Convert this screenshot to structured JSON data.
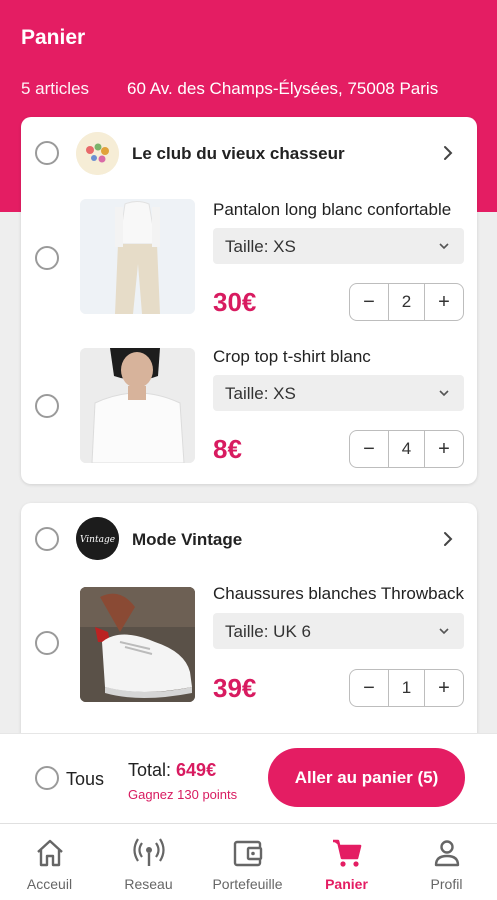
{
  "header": {
    "title": "Panier",
    "count": "5 articles",
    "address": "60 Av. des Champs-Élysées, 75008 Paris"
  },
  "shops": [
    {
      "name": "Le club du vieux chasseur",
      "logo_icon": "shop-logo-floral",
      "items": [
        {
          "title": "Pantalon long blanc confortable",
          "size": "Taille:  XS",
          "price": "30€",
          "qty": "2"
        },
        {
          "title": "Crop top t-shirt blanc",
          "size": "Taille:  XS",
          "price": "8€",
          "qty": "4"
        }
      ]
    },
    {
      "name": "Mode Vintage",
      "logo_icon": "shop-logo-vintage",
      "logo_text": "Vintage",
      "items": [
        {
          "title": "Chaussures blanches Throwback",
          "size": "Taille:  UK 6",
          "price": "39€",
          "qty": "1"
        }
      ]
    }
  ],
  "stepper": {
    "minus": "−",
    "plus": "+"
  },
  "footer": {
    "select_all": "Tous",
    "total_label": "Total: ",
    "total_value": "649€",
    "points": "Gagnez 130 points",
    "cta": "Aller au panier (5)"
  },
  "nav": [
    {
      "label": "Acceuil",
      "icon": "home-icon"
    },
    {
      "label": "Reseau",
      "icon": "broadcast-icon"
    },
    {
      "label": "Portefeuille",
      "icon": "wallet-icon"
    },
    {
      "label": "Panier",
      "icon": "cart-icon",
      "active": true
    },
    {
      "label": "Profil",
      "icon": "profile-icon"
    }
  ],
  "colors": {
    "accent": "#e41d63",
    "price": "#d81b60",
    "background": "#eeeeee"
  }
}
